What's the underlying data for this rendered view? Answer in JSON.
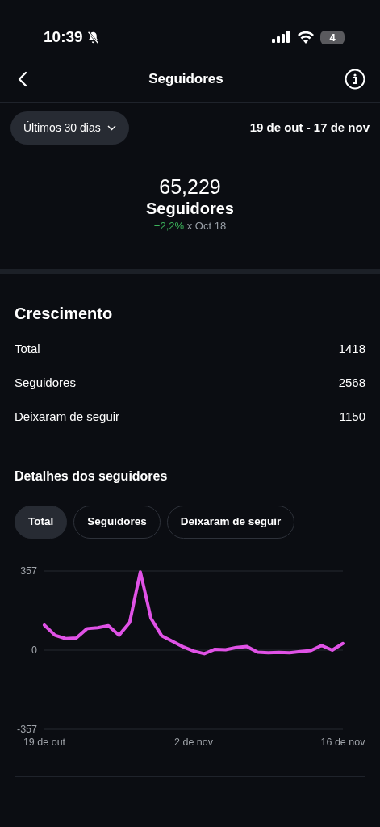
{
  "status_bar": {
    "time": "10:39",
    "battery": "4"
  },
  "header": {
    "title": "Seguidores"
  },
  "filter": {
    "period": "Últimos 30 dias",
    "range": "19 de out - 17 de nov"
  },
  "summary": {
    "value": "65,229",
    "label": "Seguidores",
    "change": "+2,2%",
    "compare": "x Oct 18"
  },
  "growth": {
    "title": "Crescimento",
    "rows": [
      {
        "label": "Total",
        "value": "1418"
      },
      {
        "label": "Seguidores",
        "value": "2568"
      },
      {
        "label": "Deixaram de seguir",
        "value": "1150"
      }
    ]
  },
  "details": {
    "title": "Detalhes dos seguidores",
    "tabs": [
      {
        "label": "Total",
        "selected": true
      },
      {
        "label": "Seguidores",
        "selected": false
      },
      {
        "label": "Deixaram de seguir",
        "selected": false
      }
    ],
    "chart_data": {
      "type": "line",
      "categories": [
        "19 de out",
        null,
        null,
        null,
        null,
        null,
        null,
        null,
        null,
        null,
        null,
        null,
        null,
        null,
        "2 de nov",
        null,
        null,
        null,
        null,
        null,
        null,
        null,
        null,
        null,
        null,
        null,
        null,
        null,
        "16 de nov"
      ],
      "series": [
        {
          "color": "#e052e6",
          "values": [
            113,
            67,
            52,
            55,
            97,
            101,
            110,
            67,
            125,
            353,
            143,
            65,
            40,
            15,
            -4,
            -16,
            4,
            2,
            12,
            16,
            -9,
            -12,
            -10,
            -12,
            -6,
            -2,
            21,
            0,
            30
          ]
        }
      ],
      "ylim": [
        -357,
        357
      ],
      "yticks": [
        -357,
        0,
        357
      ]
    }
  }
}
